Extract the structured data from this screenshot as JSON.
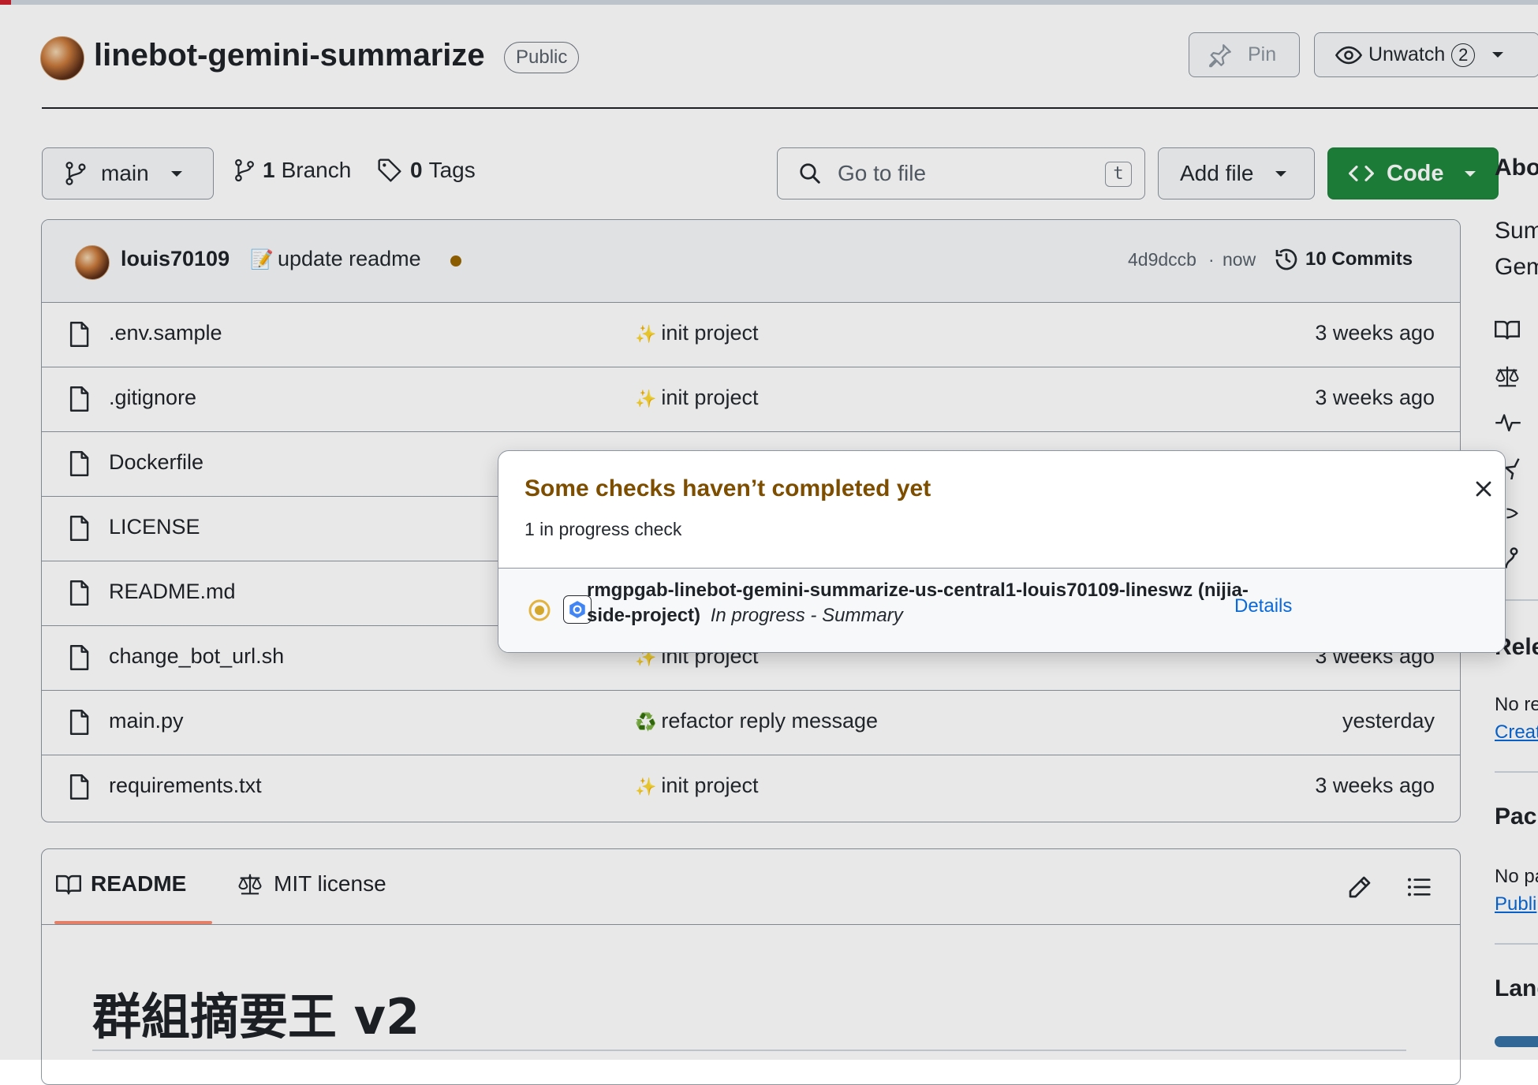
{
  "repo": {
    "name": "linebot-gemini-summarize",
    "visibility": "Public"
  },
  "header_actions": {
    "pin_label": "Pin",
    "unwatch_label": "Unwatch",
    "watch_count": "2"
  },
  "toolbar": {
    "branch": "main",
    "branches_count": "1",
    "branches_label": "Branch",
    "tags_count": "0",
    "tags_label": "Tags",
    "go_to_file_placeholder": "Go to file",
    "go_to_file_shortcut": "t",
    "add_file_label": "Add file",
    "code_label": "Code"
  },
  "latest_commit": {
    "author": "louis70109",
    "emoji": "📝",
    "message": "update readme",
    "sha": "4d9dccb",
    "time": "now",
    "commits_label": "10 Commits"
  },
  "files": [
    {
      "name": ".env.sample",
      "emoji": "✨",
      "message": "init project",
      "age": "3 weeks ago"
    },
    {
      "name": ".gitignore",
      "emoji": "✨",
      "message": "init project",
      "age": "3 weeks ago"
    },
    {
      "name": "Dockerfile",
      "emoji": "",
      "message": "",
      "age": ""
    },
    {
      "name": "LICENSE",
      "emoji": "",
      "message": "",
      "age": ""
    },
    {
      "name": "README.md",
      "emoji": "",
      "message": "",
      "age": ""
    },
    {
      "name": "change_bot_url.sh",
      "emoji": "✨",
      "message": "init project",
      "age": "3 weeks ago"
    },
    {
      "name": "main.py",
      "emoji": "♻️",
      "message": "refactor reply message",
      "age": "yesterday"
    },
    {
      "name": "requirements.txt",
      "emoji": "✨",
      "message": "init project",
      "age": "3 weeks ago"
    }
  ],
  "checks_popover": {
    "title": "Some checks haven’t completed yet",
    "subtitle": "1 in progress check",
    "check_name_line1": "rmgpgab-linebot-gemini-summarize-us-central1-louis70109-lineswz (nijia-",
    "check_name_line2": "side-project)",
    "check_status": "In progress - Summary",
    "details_label": "Details"
  },
  "readme": {
    "tab_readme": "README",
    "tab_license": "MIT license",
    "heading": "群組摘要王 v2"
  },
  "sidebar": {
    "about_title": "Abo",
    "desc_line1": "Sum",
    "desc_line2": "Gem",
    "releases_title": "Rele",
    "releases_text": "No re",
    "releases_link": "Creat",
    "packages_title": "Pac",
    "packages_text": "No pa",
    "packages_link": "Publi",
    "languages_title": "Lang"
  },
  "colors": {
    "code_button": "#1f883d",
    "popover_title": "#7d4e00",
    "link": "#0969da",
    "in_progress_dot": "#bf8700",
    "commit_status_dot": "#9a6700",
    "tab_underline": "#fd8c73"
  }
}
